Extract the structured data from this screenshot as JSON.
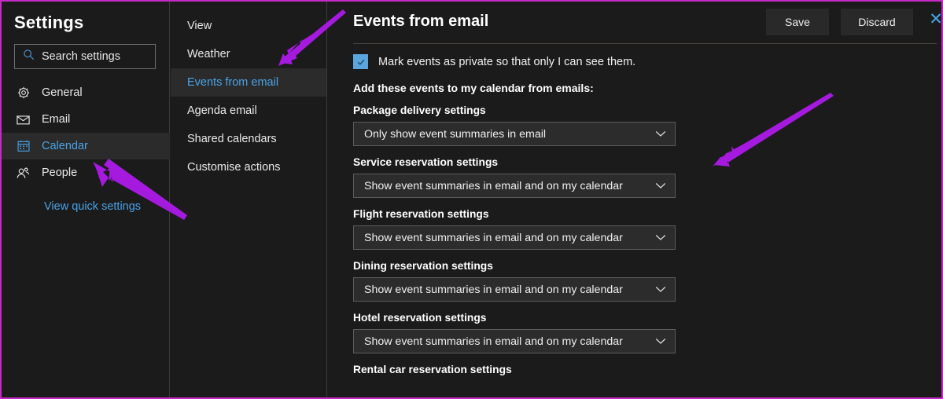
{
  "sidebar": {
    "title": "Settings",
    "search": {
      "placeholder": "Search settings",
      "icon": "search-icon"
    },
    "items": [
      {
        "label": "General",
        "icon": "gear-icon",
        "active": false
      },
      {
        "label": "Email",
        "icon": "envelope-icon",
        "active": false
      },
      {
        "label": "Calendar",
        "icon": "calendar-icon",
        "active": true
      },
      {
        "label": "People",
        "icon": "people-icon",
        "active": false
      }
    ],
    "quick_link": "View quick settings"
  },
  "midnav": {
    "items": [
      {
        "label": "View",
        "active": false
      },
      {
        "label": "Weather",
        "active": false
      },
      {
        "label": "Events from email",
        "active": true
      },
      {
        "label": "Agenda email",
        "active": false
      },
      {
        "label": "Shared calendars",
        "active": false
      },
      {
        "label": "Customise actions",
        "active": false
      }
    ]
  },
  "main": {
    "title": "Events from email",
    "save_label": "Save",
    "discard_label": "Discard",
    "close_label": "✕",
    "private_checkbox": {
      "label": "Mark events as private so that only I can see them.",
      "checked": true,
      "check_glyph": "✓"
    },
    "add_events_heading": "Add these events to my calendar from emails:",
    "settings": [
      {
        "label": "Package delivery settings",
        "value": "Only show event summaries in email"
      },
      {
        "label": "Service reservation settings",
        "value": "Show event summaries in email and on my calendar"
      },
      {
        "label": "Flight reservation settings",
        "value": "Show event summaries in email and on my calendar"
      },
      {
        "label": "Dining reservation settings",
        "value": "Show event summaries in email and on my calendar"
      },
      {
        "label": "Hotel reservation settings",
        "value": "Show event summaries in email and on my calendar"
      },
      {
        "label": "Rental car reservation settings",
        "value": null
      }
    ],
    "chevron_glyph": "⌄"
  },
  "annotations": {
    "arrow_color": "#a61ae0",
    "border_color": "#c42ac4",
    "arrows": [
      {
        "name": "arrow-to-events-from-email"
      },
      {
        "name": "arrow-to-calendar"
      },
      {
        "name": "arrow-to-main-panel"
      }
    ]
  }
}
